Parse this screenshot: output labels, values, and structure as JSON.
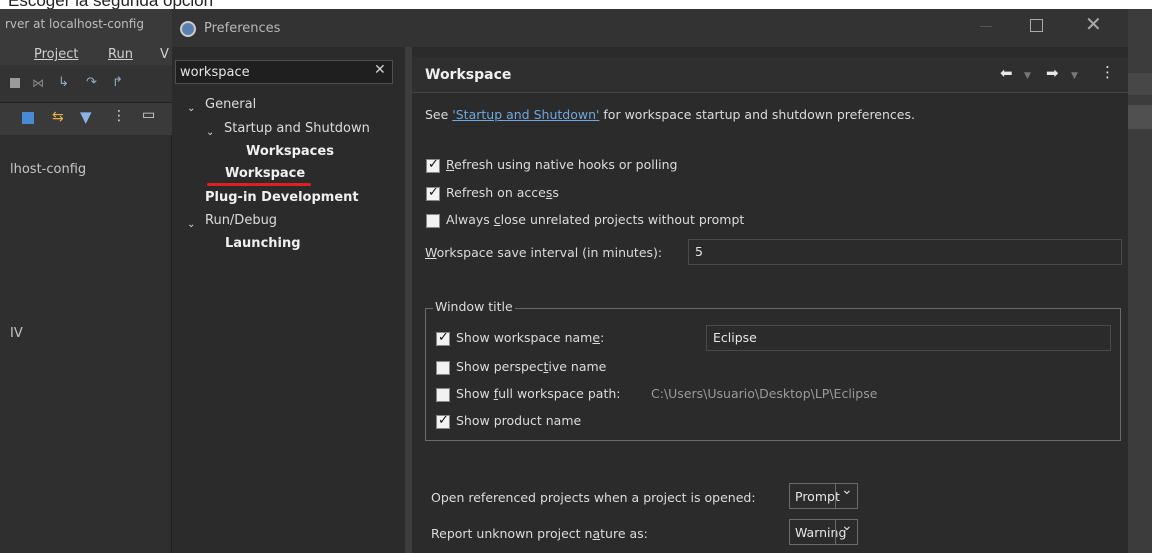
{
  "caption": "Escoger la segunda opción",
  "background_window": {
    "title": "rver at localhost-config",
    "menu": [
      "Project",
      "Run",
      "V"
    ],
    "host_label": "lhost-config",
    "side_label": "IV"
  },
  "dialog": {
    "title": "Preferences"
  },
  "tree": {
    "filter_value": "workspace",
    "items": [
      {
        "label": "General"
      },
      {
        "label": "Startup and Shutdown"
      },
      {
        "label": "Workspaces"
      },
      {
        "label": "Workspace"
      },
      {
        "label": "Plug-in Development"
      },
      {
        "label": "Run/Debug"
      },
      {
        "label": "Launching"
      }
    ]
  },
  "page": {
    "title": "Workspace",
    "desc_prefix": "See ",
    "desc_link": "'Startup and Shutdown'",
    "desc_suffix": " for workspace startup and shutdown preferences.",
    "refresh_native": {
      "pre": "",
      "mn": "R",
      "post": "efresh using native hooks or polling",
      "checked": true
    },
    "refresh_access": {
      "pre": "Refresh on acce",
      "mn": "s",
      "post": "s",
      "checked": true
    },
    "close_unrelated": {
      "pre": "Always ",
      "mn": "c",
      "post": "lose unrelated projects without prompt",
      "checked": false
    },
    "save_interval": {
      "pre": "",
      "mn": "W",
      "post": "orkspace save interval (in minutes):",
      "value": "5"
    },
    "window_title": {
      "legend": "Window title",
      "show_ws_name": {
        "pre": "Show workspace nam",
        "mn": "e",
        "post": ":",
        "checked": true,
        "value": "Eclipse"
      },
      "show_perspective": {
        "pre": "Show perspec",
        "mn": "t",
        "post": "ive name",
        "checked": false
      },
      "show_full_path": {
        "pre": "Show ",
        "mn": "f",
        "post": "ull workspace path:",
        "checked": false,
        "value": "C:\\Users\\Usuario\\Desktop\\LP\\Eclipse"
      },
      "show_product": {
        "pre": "Show product name",
        "mn": "",
        "post": "",
        "checked": true
      }
    },
    "open_referenced": {
      "label": "Open referenced projects when a project is opened:",
      "value": "Prompt"
    },
    "unknown_nature": {
      "pre": "Report unknown project n",
      "mn": "a",
      "post": "ture as:",
      "value": "Warning"
    }
  }
}
